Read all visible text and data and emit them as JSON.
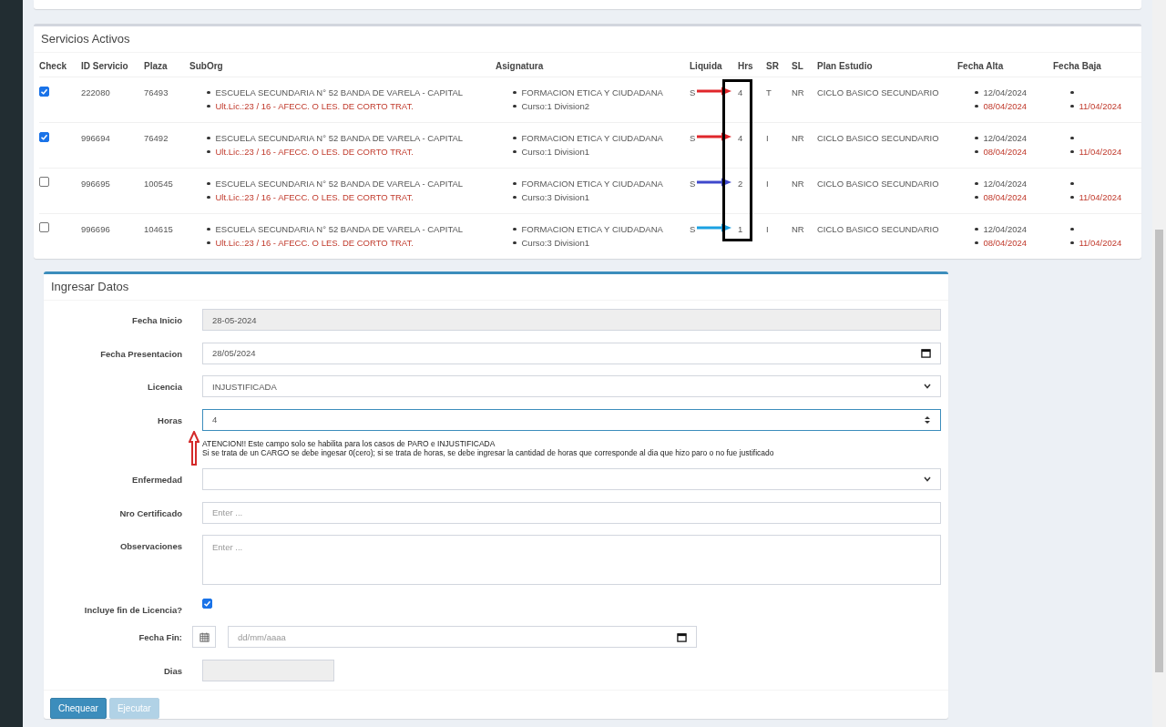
{
  "services": {
    "title": "Servicios Activos",
    "columns": [
      "Check",
      "ID Servicio",
      "Plaza",
      "SubOrg",
      "Asignatura",
      "Liquida",
      "Hrs",
      "SR",
      "SL",
      "Plan Estudio",
      "Fecha Alta",
      "Fecha Baja"
    ],
    "rows": [
      {
        "checked": true,
        "id": "222080",
        "plaza": "76493",
        "suborg": [
          {
            "text": "ESCUELA SECUNDARIA N° 52 BANDA DE VARELA - CAPITAL",
            "alert": false
          },
          {
            "text": "Ult.Lic.:23 / 16 - AFECC. O LES. DE CORTO TRAT.",
            "alert": true
          }
        ],
        "asignatura": [
          {
            "text": "FORMACION ETICA Y CIUDADANA",
            "alert": false
          },
          {
            "text": "Curso:1 Division2",
            "alert": false
          }
        ],
        "liquida": "S",
        "hrs": "4",
        "sr": "T",
        "sl": "NR",
        "plan": "CICLO BASICO SECUNDARIO",
        "alta": [
          {
            "text": "12/04/2024",
            "alert": false
          },
          {
            "text": "08/04/2024",
            "alert": true
          }
        ],
        "baja": [
          {
            "kind": "blank"
          },
          {
            "kind": "text",
            "text": "11/04/2024",
            "alert": true
          }
        ],
        "hrs_arrow": {
          "color": "#e0262b"
        }
      },
      {
        "checked": true,
        "id": "996694",
        "plaza": "76492",
        "suborg": [
          {
            "text": "ESCUELA SECUNDARIA N° 52 BANDA DE VARELA - CAPITAL",
            "alert": false
          },
          {
            "text": "Ult.Lic.:23 / 16 - AFECC. O LES. DE CORTO TRAT.",
            "alert": true
          }
        ],
        "asignatura": [
          {
            "text": "FORMACION ETICA Y CIUDADANA",
            "alert": false
          },
          {
            "text": "Curso:1 Division1",
            "alert": false
          }
        ],
        "liquida": "S",
        "hrs": "4",
        "sr": "I",
        "sl": "NR",
        "plan": "CICLO BASICO SECUNDARIO",
        "alta": [
          {
            "text": "12/04/2024",
            "alert": false
          },
          {
            "text": "08/04/2024",
            "alert": true
          }
        ],
        "baja": [
          {
            "kind": "blank"
          },
          {
            "kind": "text",
            "text": "11/04/2024",
            "alert": true
          }
        ],
        "hrs_arrow": {
          "color": "#e0262b"
        }
      },
      {
        "checked": false,
        "id": "996695",
        "plaza": "100545",
        "suborg": [
          {
            "text": "ESCUELA SECUNDARIA N° 52 BANDA DE VARELA - CAPITAL",
            "alert": false
          },
          {
            "text": "Ult.Lic.:23 / 16 - AFECC. O LES. DE CORTO TRAT.",
            "alert": true
          }
        ],
        "asignatura": [
          {
            "text": "FORMACION ETICA Y CIUDADANA",
            "alert": false
          },
          {
            "text": "Curso:3 Division1",
            "alert": false
          }
        ],
        "liquida": "S",
        "hrs": "2",
        "sr": "I",
        "sl": "NR",
        "plan": "CICLO BASICO SECUNDARIO",
        "alta": [
          {
            "text": "12/04/2024",
            "alert": false
          },
          {
            "text": "08/04/2024",
            "alert": true
          }
        ],
        "baja": [
          {
            "kind": "blank"
          },
          {
            "kind": "text",
            "text": "11/04/2024",
            "alert": true
          }
        ],
        "hrs_arrow": {
          "color": "#3f48cc"
        }
      },
      {
        "checked": false,
        "id": "996696",
        "plaza": "104615",
        "suborg": [
          {
            "text": "ESCUELA SECUNDARIA N° 52 BANDA DE VARELA - CAPITAL",
            "alert": false
          },
          {
            "text": "Ult.Lic.:23 / 16 - AFECC. O LES. DE CORTO TRAT.",
            "alert": true
          }
        ],
        "asignatura": [
          {
            "text": "FORMACION ETICA Y CIUDADANA",
            "alert": false
          },
          {
            "text": "Curso:3 Division1",
            "alert": false
          }
        ],
        "liquida": "S",
        "hrs": "1",
        "sr": "I",
        "sl": "NR",
        "plan": "CICLO BASICO SECUNDARIO",
        "alta": [
          {
            "text": "12/04/2024",
            "alert": false
          },
          {
            "text": "08/04/2024",
            "alert": true
          }
        ],
        "baja": [
          {
            "kind": "blank"
          },
          {
            "kind": "text",
            "text": "11/04/2024",
            "alert": true
          }
        ],
        "hrs_arrow": {
          "color": "#1ba1e2"
        }
      }
    ]
  },
  "form": {
    "title": "Ingresar Datos",
    "fields": [
      {
        "kind": "text",
        "label": "Fecha Inicio",
        "value": "28-05-2024",
        "disabled": true
      },
      {
        "kind": "date",
        "label": "Fecha Presentacion",
        "value": "28/05/2024",
        "disabled": false
      },
      {
        "kind": "select",
        "label": "Licencia",
        "value": "INJUSTIFICADA"
      },
      {
        "kind": "number",
        "label": "Horas",
        "value": "4",
        "help": [
          "ATENCION!! Este campo solo se habilita para los casos de PARO e INJUSTIFICADA",
          "Si se trata de un CARGO se debe ingesar 0(cero); si se trata de horas, se debe ingresar la cantidad de horas que corresponde al dia que hizo paro o no fue justificado"
        ],
        "arrow": {
          "color": "#d42a2a"
        }
      },
      {
        "kind": "select",
        "label": "Enfermedad"
      },
      {
        "kind": "text",
        "label": "Nro Certificado",
        "placeholder": "Enter ...",
        "disabled": false
      },
      {
        "kind": "textarea",
        "label": "Observaciones",
        "placeholder": "Enter ..."
      },
      {
        "kind": "checkbox",
        "label": "Incluye fin de Licencia?",
        "checked": true
      },
      {
        "kind": "date_addon",
        "label": "Fecha Fin:",
        "placeholder": "dd/mm/aaaa"
      },
      {
        "kind": "small",
        "label": "Dias",
        "disabled": true
      }
    ],
    "buttons": [
      {
        "label": "Chequear",
        "disabled": false
      },
      {
        "label": "Ejecutar",
        "disabled": true
      }
    ]
  }
}
